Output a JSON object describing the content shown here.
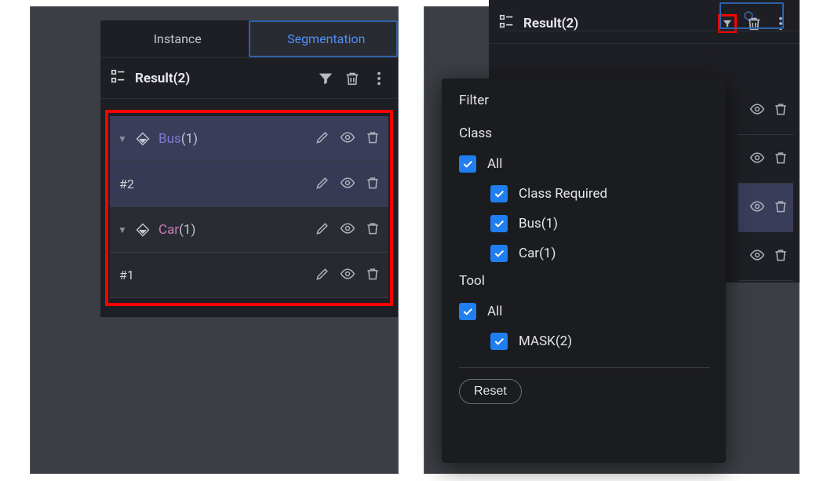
{
  "left": {
    "tabs": {
      "instance": "Instance",
      "segmentation": "Segmentation"
    },
    "result_title": "Result(2)",
    "groups": [
      {
        "label": "Bus",
        "count": "(1)",
        "child": "#2",
        "style": "bus"
      },
      {
        "label": "Car",
        "count": "(1)",
        "child": "#1",
        "style": "car"
      }
    ]
  },
  "right": {
    "result_title": "Result(2)"
  },
  "filter": {
    "title": "Filter",
    "class_label": "Class",
    "tool_label": "Tool",
    "all": "All",
    "options_class": [
      "Class Required",
      "Bus(1)",
      "Car(1)"
    ],
    "options_tool": [
      "MASK(2)"
    ],
    "reset": "Reset"
  }
}
